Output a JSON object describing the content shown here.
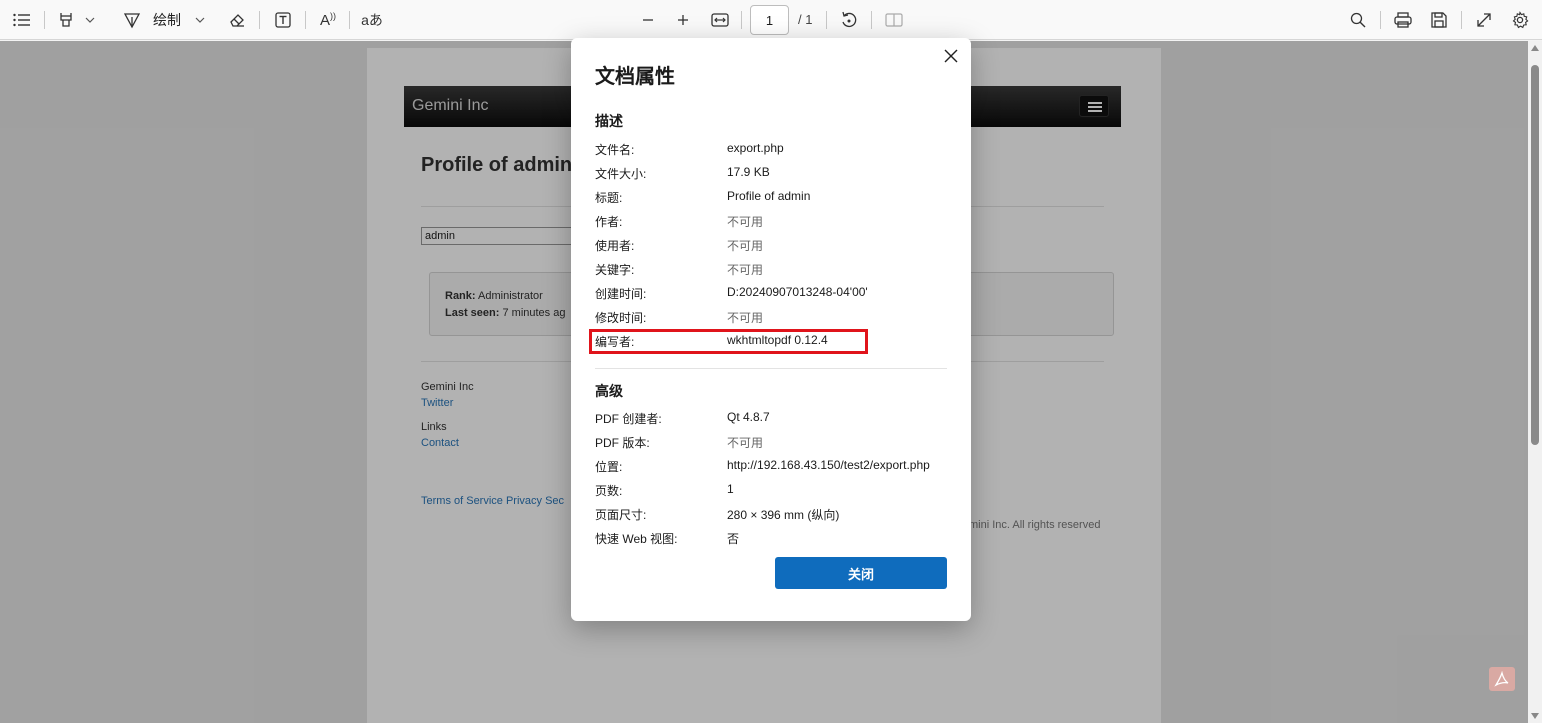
{
  "toolbar": {
    "draw_label": "绘制",
    "page_number": "1",
    "page_total": "/ 1",
    "read_aloud_glyph": "aあ",
    "text_size_glyph": "A"
  },
  "pdf": {
    "brand": "Gemini Inc",
    "heading": "Profile of admin",
    "input_value": "admin",
    "rank_label": "Rank:",
    "rank_value": "Administrator",
    "last_seen_label": "Last seen:",
    "last_seen_value": "7 minutes ag",
    "footer_company": "Gemini Inc",
    "footer_twitter": "Twitter",
    "footer_links": "Links",
    "footer_contact": "Contact",
    "footer_terms": "Terms of Service Privacy Sec",
    "footer_copyright": "mini Inc. All rights reserved"
  },
  "dialog": {
    "title": "文档属性",
    "section_description": "描述",
    "section_advanced": "高级",
    "close_button": "关闭",
    "description_rows": [
      {
        "label": "文件名:",
        "value": "export.php"
      },
      {
        "label": "文件大小:",
        "value": "17.9 KB"
      },
      {
        "label": "标题:",
        "value": "Profile of admin"
      },
      {
        "label": "作者:",
        "value": "不可用"
      },
      {
        "label": "使用者:",
        "value": "不可用"
      },
      {
        "label": "关键字:",
        "value": "不可用"
      },
      {
        "label": "创建时间:",
        "value": "D:20240907013248-04'00'"
      },
      {
        "label": "修改时间:",
        "value": "不可用"
      },
      {
        "label": "编写者:",
        "value": "wkhtmltopdf 0.12.4"
      }
    ],
    "advanced_rows": [
      {
        "label": "PDF 创建者:",
        "value": "Qt 4.8.7"
      },
      {
        "label": "PDF 版本:",
        "value": "不可用"
      },
      {
        "label": "位置:",
        "value": "http://192.168.43.150/test2/export.php"
      },
      {
        "label": "页数:",
        "value": "1"
      },
      {
        "label": "页面尺寸:",
        "value": "280 × 396 mm (纵向)"
      },
      {
        "label": "快速 Web 视图:",
        "value": "否"
      }
    ]
  },
  "colors": {
    "accent": "#0f6cbd",
    "highlight": "#e0141b"
  }
}
